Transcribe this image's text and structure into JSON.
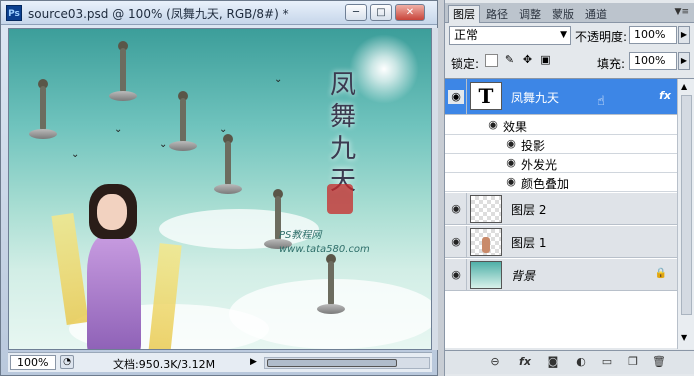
{
  "document": {
    "title": "source03.psd @ 100% (凤舞九天, RGB/8#) *",
    "app_icon": "Ps",
    "window_buttons": {
      "minimize": "─",
      "restore": "□",
      "close": "✕"
    },
    "status": {
      "zoom": "100%",
      "doc_info": "文档:950.3K/3.12M"
    }
  },
  "artwork": {
    "calligraphy": "凤舞九天",
    "watermark_line1": "PS教程网",
    "watermark_line2": "www.tata580.com"
  },
  "panel": {
    "tabs": [
      "图层",
      "路径",
      "调整",
      "蒙版",
      "通道"
    ],
    "active_tab": 0,
    "blend_mode": "正常",
    "opacity_label": "不透明度:",
    "opacity_value": "100%",
    "lock_label": "锁定:",
    "fill_label": "填充:",
    "fill_value": "100%",
    "layers": [
      {
        "name": "凤舞九天",
        "type": "text",
        "thumb_glyph": "T",
        "selected": true,
        "has_fx": true,
        "fx_label": "fx"
      },
      {
        "name": "图层 2",
        "type": "pixel",
        "selected": false
      },
      {
        "name": "图层 1",
        "type": "pixel",
        "selected": false
      },
      {
        "name": "背景",
        "type": "background",
        "selected": false,
        "locked": true
      }
    ],
    "effects_header": "效果",
    "effects": [
      "投影",
      "外发光",
      "颜色叠加"
    ],
    "footer_icons": [
      "link-icon",
      "fx-icon",
      "mask-icon",
      "adjustment-icon",
      "group-icon",
      "new-layer-icon",
      "delete-icon"
    ],
    "footer_fx_label": "fx"
  },
  "colors": {
    "selected_layer": "#3d86e6",
    "panel_bg": "#e4e8ec"
  }
}
